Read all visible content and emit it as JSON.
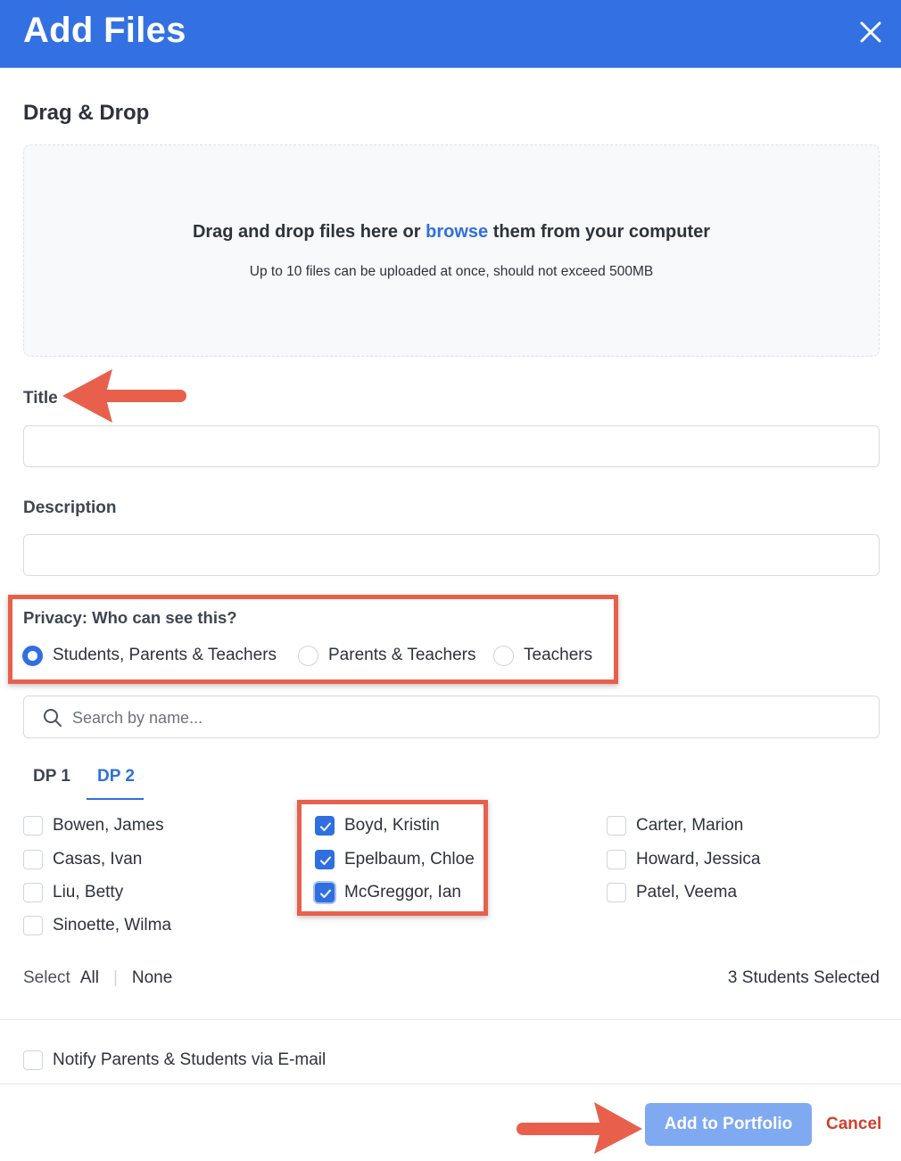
{
  "header": {
    "title": "Add Files",
    "close_icon": "close-icon"
  },
  "upload": {
    "heading": "Drag & Drop",
    "prompt_before": "Drag and drop files here or ",
    "browse_label": "browse",
    "prompt_after": " them from your computer",
    "limit_note": "Up to 10 files can be uploaded at once, should not exceed 500MB"
  },
  "title_field": {
    "label": "Title",
    "value": ""
  },
  "description_field": {
    "label": "Description",
    "value": ""
  },
  "privacy": {
    "label": "Privacy: Who can see this?",
    "options": [
      {
        "label": "Students, Parents & Teachers",
        "selected": true
      },
      {
        "label": "Parents & Teachers",
        "selected": false
      },
      {
        "label": "Teachers",
        "selected": false
      }
    ]
  },
  "search": {
    "placeholder": "Search by name...",
    "icon": "search-icon"
  },
  "tabs": [
    {
      "label": "DP 1",
      "active": false
    },
    {
      "label": "DP 2",
      "active": true
    }
  ],
  "students": [
    {
      "name": "Bowen, James",
      "checked": false
    },
    {
      "name": "Casas, Ivan",
      "checked": false
    },
    {
      "name": "Liu, Betty",
      "checked": false
    },
    {
      "name": "Sinoette, Wilma",
      "checked": false
    },
    {
      "name": "Boyd, Kristin",
      "checked": true
    },
    {
      "name": "Epelbaum, Chloe",
      "checked": true
    },
    {
      "name": "McGreggor, Ian",
      "checked": true
    },
    {
      "name": "Carter, Marion",
      "checked": false
    },
    {
      "name": "Howard, Jessica",
      "checked": false
    },
    {
      "name": "Patel, Veema",
      "checked": false
    }
  ],
  "selection": {
    "prefix": "Select",
    "all_label": "All",
    "separator": "|",
    "none_label": "None",
    "count_label": "3 Students Selected"
  },
  "notify": {
    "label": "Notify Parents & Students via E-mail",
    "checked": false
  },
  "actions": {
    "primary_label": "Add to Portfolio",
    "cancel_label": "Cancel"
  },
  "colors": {
    "header_bg": "#3371e3",
    "accent": "#2f6fe0",
    "primary_button": "#7fa9f0",
    "cancel": "#d03f2f",
    "annotation": "#e8604c"
  }
}
